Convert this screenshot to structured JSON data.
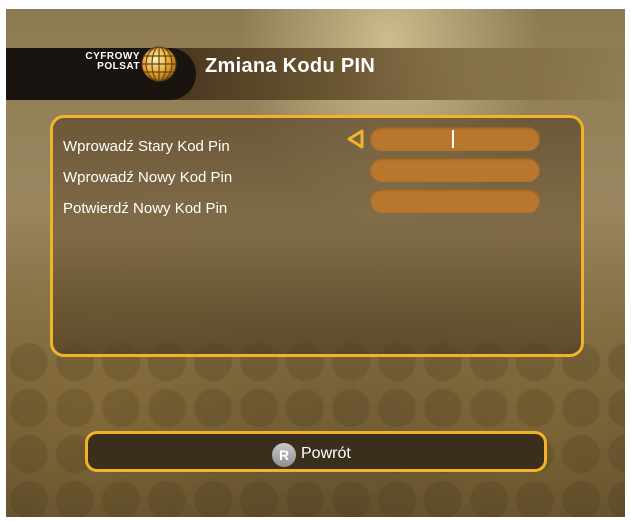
{
  "header": {
    "logo_line1": "CYFROWY",
    "logo_line2": "POLSAT",
    "title": "Zmiana Kodu PIN"
  },
  "form": {
    "fields": [
      {
        "label": "Wprowadź Stary Kod Pin",
        "value": "",
        "focused": true
      },
      {
        "label": "Wprowadź Nowy Kod Pin",
        "value": "",
        "focused": false
      },
      {
        "label": "Potwierdź Nowy Kod Pin",
        "value": "",
        "focused": false
      }
    ]
  },
  "footer": {
    "key_label": "R",
    "back_label": "Powrót"
  },
  "icons": {
    "logo": "globe-logo-icon",
    "focus": "triangle-left-pointer-icon"
  },
  "colors": {
    "accent": "#f0b428",
    "field": "#b9762d",
    "text": "#ffffff"
  }
}
